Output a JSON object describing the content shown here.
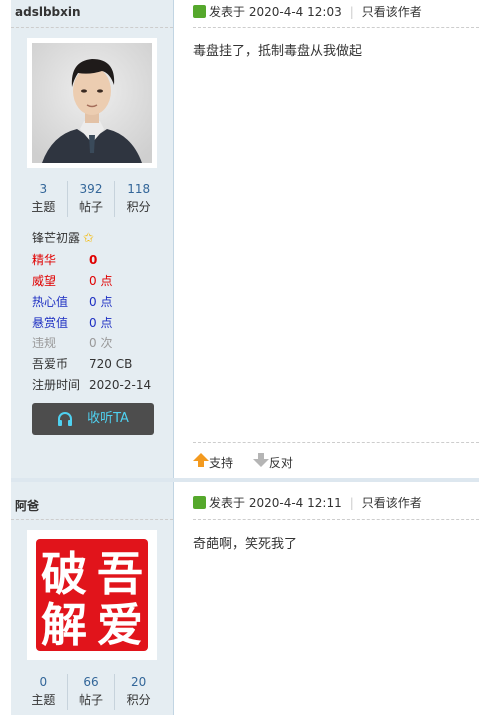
{
  "posts": [
    {
      "username": "adslbbxin",
      "stats": [
        {
          "value": "3",
          "label": "主题"
        },
        {
          "value": "392",
          "label": "帖子"
        },
        {
          "value": "118",
          "label": "积分"
        }
      ],
      "rank": "锋芒初露",
      "info": [
        {
          "key": "精华",
          "value": "0",
          "color": "#e00000",
          "bold": true
        },
        {
          "key": "威望",
          "value": "0 点",
          "color": "#e00000"
        },
        {
          "key": "热心值",
          "value": "0 点",
          "color": "#1d2fc2"
        },
        {
          "key": "悬赏值",
          "value": "0 点",
          "color": "#1d2fc2"
        },
        {
          "key": "违规",
          "value": "0 次",
          "color": "#999999"
        },
        {
          "key": "吾爱币",
          "value": "720 CB",
          "color": "#333333"
        },
        {
          "key": "注册时间",
          "value": "2020-2-14",
          "color": "#333333"
        }
      ],
      "listen_label": "收听TA",
      "posted_prefix": "发表于",
      "posted_time": "2020-4-4 12:03",
      "only_author": "只看该作者",
      "content": "毒盘挂了，抵制毒盘从我做起",
      "support_label": "支持",
      "oppose_label": "反对"
    },
    {
      "username": "阿爸",
      "avatar_chars": [
        "破",
        "吾",
        "解",
        "爱"
      ],
      "stats": [
        {
          "value": "0",
          "label": "主题"
        },
        {
          "value": "66",
          "label": "帖子"
        },
        {
          "value": "20",
          "label": "积分"
        }
      ],
      "posted_prefix": "发表于",
      "posted_time": "2020-4-4 12:11",
      "only_author": "只看该作者",
      "content": "奇葩啊，笑死我了"
    }
  ]
}
